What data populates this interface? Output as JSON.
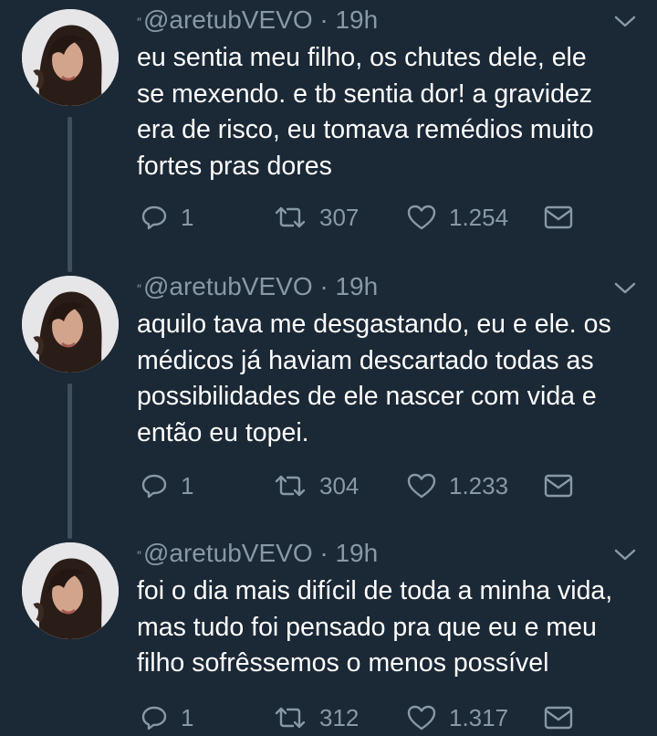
{
  "tweets": [
    {
      "handle": "@aretubVEVO",
      "time": "19h",
      "lines": [
        "eu sentia meu filho, os chutes dele, ele",
        "se mexendo. e tb sentia dor! a gravidez",
        "era de risco, eu tomava remédios muito",
        "fortes pras dores"
      ],
      "replies": "1",
      "retweets": "307",
      "likes": "1.254"
    },
    {
      "handle": "@aretubVEVO",
      "time": "19h",
      "lines": [
        "aquilo tava me desgastando, eu e ele. os",
        "médicos já haviam descartado todas as",
        "possibilidades de ele nascer com vida e",
        "então eu topei."
      ],
      "replies": "1",
      "retweets": "304",
      "likes": "1.233"
    },
    {
      "handle": "@aretubVEVO",
      "time": "19h",
      "lines": [
        "foi o dia mais difícil de toda a minha vida,",
        "mas tudo foi pensado pra que eu e meu",
        "filho sofrêssemos o menos possível"
      ],
      "replies": "1",
      "retweets": "312",
      "likes": "1.317"
    }
  ],
  "icons": {
    "reply": "reply-icon",
    "retweet": "retweet-icon",
    "like": "heart-icon",
    "message": "direct-message-icon",
    "caret": "chevron-down-icon"
  },
  "colors": {
    "background": "#1b2836",
    "muted": "#8899a6",
    "text": "#ffffff",
    "thread_line": "#3f4e5d"
  }
}
